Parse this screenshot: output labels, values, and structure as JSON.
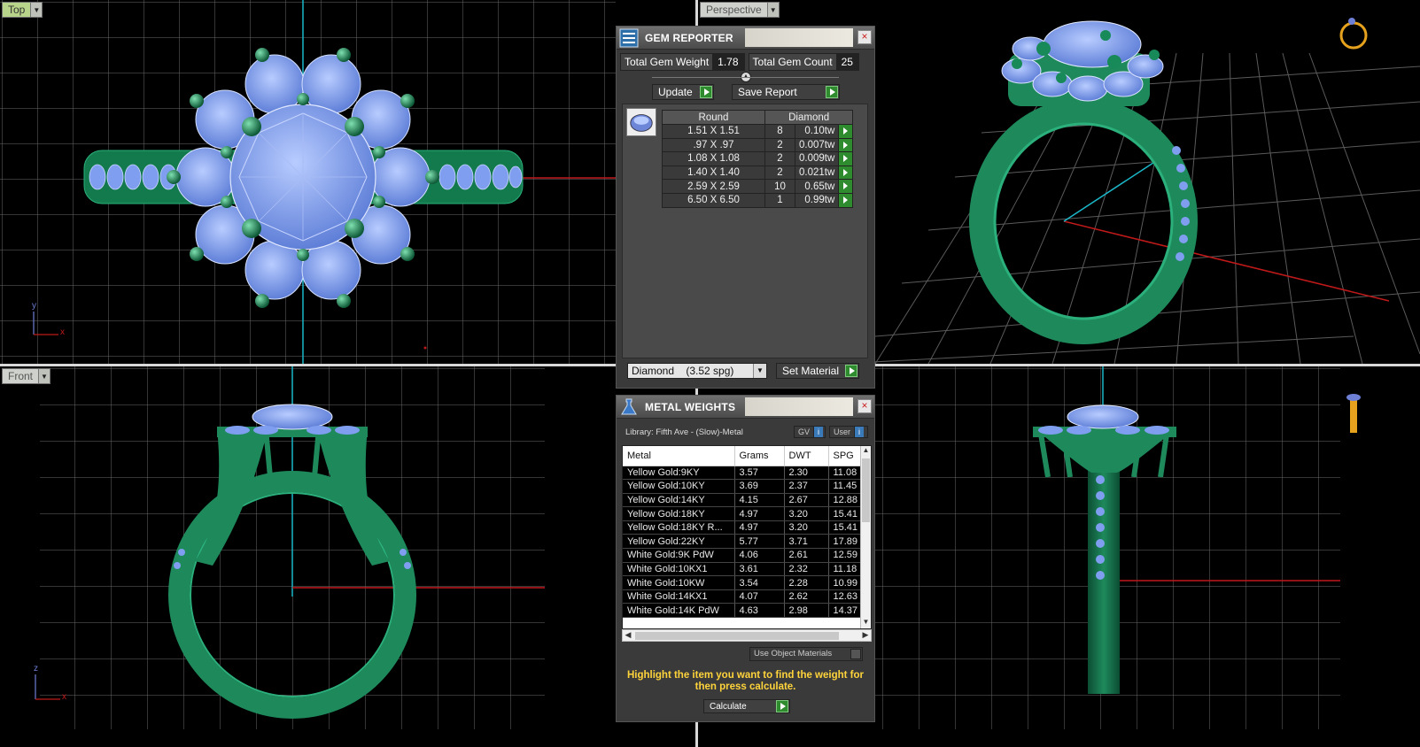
{
  "viewports": {
    "top": {
      "label": "Top"
    },
    "perspective": {
      "label": "Perspective"
    },
    "front": {
      "label": "Front"
    },
    "axes_top": {
      "y": "y",
      "x": "x"
    },
    "axes_front": {
      "z": "z",
      "x": "x"
    }
  },
  "gem_reporter": {
    "title": "GEM REPORTER",
    "close": "×",
    "total_weight_label": "Total Gem Weight",
    "total_weight": "1.78",
    "total_count_label": "Total Gem Count",
    "total_count": "25",
    "update_label": "Update",
    "save_report_label": "Save Report",
    "table": {
      "headers": [
        "Round",
        "Diamond"
      ],
      "rows": [
        {
          "size": "1.51 X 1.51",
          "count": "8",
          "weight": "0.10tw"
        },
        {
          "size": ".97 X .97",
          "count": "2",
          "weight": "0.007tw"
        },
        {
          "size": "1.08 X 1.08",
          "count": "2",
          "weight": "0.009tw"
        },
        {
          "size": "1.40 X 1.40",
          "count": "2",
          "weight": "0.021tw"
        },
        {
          "size": "2.59 X 2.59",
          "count": "10",
          "weight": "0.65tw"
        },
        {
          "size": "6.50 X 6.50",
          "count": "1",
          "weight": "0.99tw"
        }
      ]
    },
    "material_select": "Diamond    (3.52 spg)",
    "set_material_label": "Set Material"
  },
  "metal_weights": {
    "title": "METAL WEIGHTS",
    "close": "×",
    "library": "Library: Fifth Ave - (Slow)-Metal",
    "gv_label": "GV",
    "user_label": "User",
    "info": "i",
    "headers": [
      "Metal",
      "Grams",
      "DWT",
      "SPG"
    ],
    "rows": [
      {
        "metal": "Yellow Gold:9KY",
        "grams": "3.57",
        "dwt": "2.30",
        "spg": "11.08"
      },
      {
        "metal": "Yellow Gold:10KY",
        "grams": "3.69",
        "dwt": "2.37",
        "spg": "11.45"
      },
      {
        "metal": "Yellow Gold:14KY",
        "grams": "4.15",
        "dwt": "2.67",
        "spg": "12.88"
      },
      {
        "metal": "Yellow Gold:18KY",
        "grams": "4.97",
        "dwt": "3.20",
        "spg": "15.41"
      },
      {
        "metal": "Yellow Gold:18KY R...",
        "grams": "4.97",
        "dwt": "3.20",
        "spg": "15.41"
      },
      {
        "metal": "Yellow Gold:22KY",
        "grams": "5.77",
        "dwt": "3.71",
        "spg": "17.89"
      },
      {
        "metal": "White Gold:9K PdW",
        "grams": "4.06",
        "dwt": "2.61",
        "spg": "12.59"
      },
      {
        "metal": "White Gold:10KX1",
        "grams": "3.61",
        "dwt": "2.32",
        "spg": "11.18"
      },
      {
        "metal": "White Gold:10KW",
        "grams": "3.54",
        "dwt": "2.28",
        "spg": "10.99"
      },
      {
        "metal": "White Gold:14KX1",
        "grams": "4.07",
        "dwt": "2.62",
        "spg": "12.63"
      },
      {
        "metal": "White Gold:14K PdW",
        "grams": "4.63",
        "dwt": "2.98",
        "spg": "14.37"
      }
    ],
    "use_object_materials": "Use Object Materials",
    "hint": "Highlight the item you want to find the weight for then press calculate.",
    "calculate_label": "Calculate"
  },
  "colors": {
    "grid": "#6a6a6a",
    "metal": "#1e8a5c",
    "gem": "#7f9ef0",
    "axis_red": "#c0191a",
    "axis_cyan": "#1bb7c9",
    "accent_green": "#2e8b2e"
  }
}
